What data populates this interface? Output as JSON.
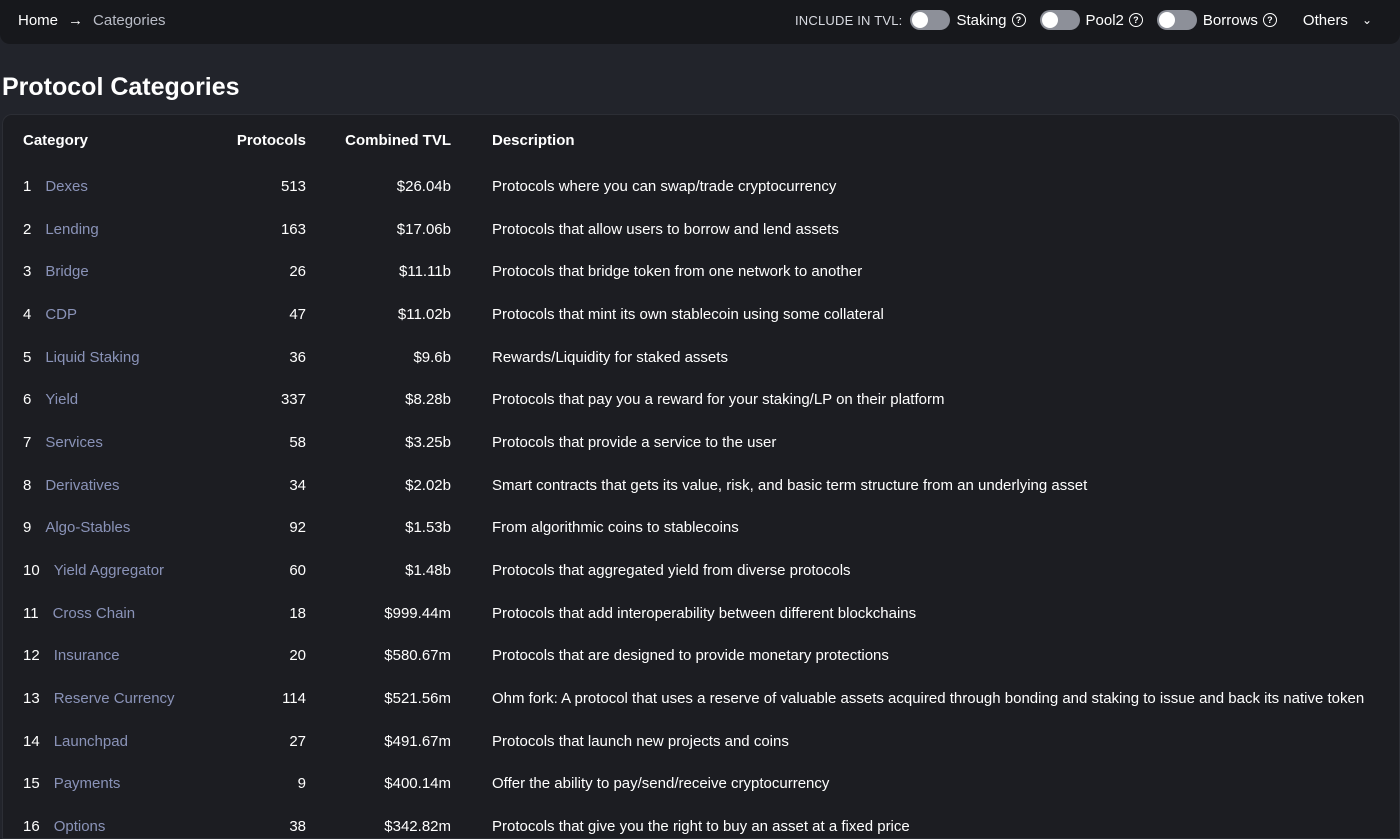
{
  "breadcrumb": {
    "home": "Home",
    "current": "Categories"
  },
  "tvl_settings": {
    "label": "INCLUDE IN TVL:",
    "toggles": [
      {
        "label": "Staking",
        "enabled": false
      },
      {
        "label": "Pool2",
        "enabled": false
      },
      {
        "label": "Borrows",
        "enabled": false
      }
    ],
    "others_label": "Others"
  },
  "page_title": "Protocol Categories",
  "table": {
    "headers": {
      "category": "Category",
      "protocols": "Protocols",
      "tvl": "Combined TVL",
      "description": "Description"
    },
    "rows": [
      {
        "rank": "1",
        "category": "Dexes",
        "protocols": "513",
        "tvl": "$26.04b",
        "description": "Protocols where you can swap/trade cryptocurrency"
      },
      {
        "rank": "2",
        "category": "Lending",
        "protocols": "163",
        "tvl": "$17.06b",
        "description": "Protocols that allow users to borrow and lend assets"
      },
      {
        "rank": "3",
        "category": "Bridge",
        "protocols": "26",
        "tvl": "$11.11b",
        "description": "Protocols that bridge token from one network to another"
      },
      {
        "rank": "4",
        "category": "CDP",
        "protocols": "47",
        "tvl": "$11.02b",
        "description": "Protocols that mint its own stablecoin using some collateral"
      },
      {
        "rank": "5",
        "category": "Liquid Staking",
        "protocols": "36",
        "tvl": "$9.6b",
        "description": "Rewards/Liquidity for staked assets"
      },
      {
        "rank": "6",
        "category": "Yield",
        "protocols": "337",
        "tvl": "$8.28b",
        "description": "Protocols that pay you a reward for your staking/LP on their platform"
      },
      {
        "rank": "7",
        "category": "Services",
        "protocols": "58",
        "tvl": "$3.25b",
        "description": "Protocols that provide a service to the user"
      },
      {
        "rank": "8",
        "category": "Derivatives",
        "protocols": "34",
        "tvl": "$2.02b",
        "description": "Smart contracts that gets its value, risk, and basic term structure from an underlying asset"
      },
      {
        "rank": "9",
        "category": "Algo-Stables",
        "protocols": "92",
        "tvl": "$1.53b",
        "description": "From algorithmic coins to stablecoins"
      },
      {
        "rank": "10",
        "category": "Yield Aggregator",
        "protocols": "60",
        "tvl": "$1.48b",
        "description": "Protocols that aggregated yield from diverse protocols"
      },
      {
        "rank": "11",
        "category": "Cross Chain",
        "protocols": "18",
        "tvl": "$999.44m",
        "description": "Protocols that add interoperability between different blockchains"
      },
      {
        "rank": "12",
        "category": "Insurance",
        "protocols": "20",
        "tvl": "$580.67m",
        "description": "Protocols that are designed to provide monetary protections"
      },
      {
        "rank": "13",
        "category": "Reserve Currency",
        "protocols": "114",
        "tvl": "$521.56m",
        "description": "Ohm fork: A protocol that uses a reserve of valuable assets acquired through bonding and staking to issue and back its native token"
      },
      {
        "rank": "14",
        "category": "Launchpad",
        "protocols": "27",
        "tvl": "$491.67m",
        "description": "Protocols that launch new projects and coins"
      },
      {
        "rank": "15",
        "category": "Payments",
        "protocols": "9",
        "tvl": "$400.14m",
        "description": "Offer the ability to pay/send/receive cryptocurrency"
      },
      {
        "rank": "16",
        "category": "Options",
        "protocols": "38",
        "tvl": "$342.82m",
        "description": "Protocols that give you the right to buy an asset at a fixed price"
      }
    ]
  },
  "colors": {
    "background": "#22242b",
    "panel": "#1c1d22",
    "topbar": "#17181c",
    "category_link": "#8a93b8",
    "toggle_off": "#8d9099"
  }
}
